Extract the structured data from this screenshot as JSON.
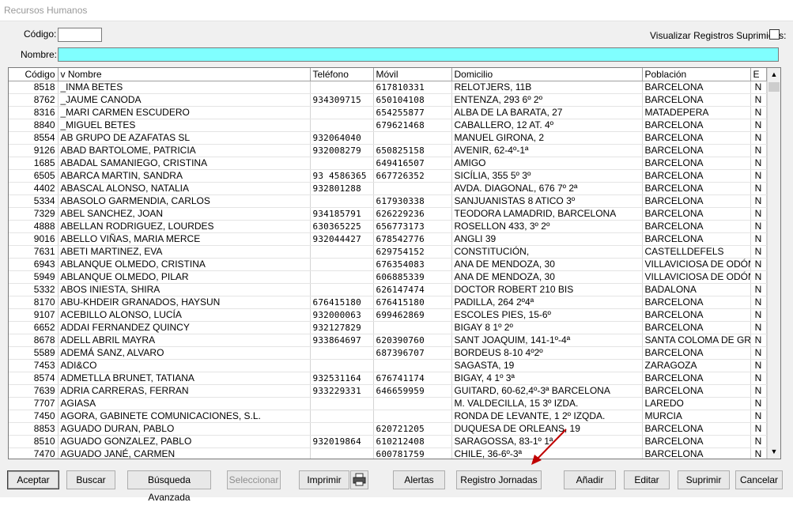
{
  "window": {
    "title": "Recursos Humanos"
  },
  "filters": {
    "codigo_label": "Código:",
    "codigo_value": "",
    "nombre_label": "Nombre:",
    "nombre_value": "",
    "suprimidos_label": "Visualizar Registros Suprimidos:",
    "suprimidos_checked": false
  },
  "grid": {
    "columns": [
      "Código",
      "v Nombre",
      "Teléfono",
      "Móvil",
      "Domicilio",
      "Población",
      "E"
    ],
    "rows": [
      [
        "8518",
        "_INMA BETES",
        "",
        "617810331",
        "RELOTJERS, 11B",
        "BARCELONA",
        "N"
      ],
      [
        "8762",
        "_JAUME CANODA",
        "934309715",
        "650104108",
        "ENTENZA, 293 6º 2º",
        "BARCELONA",
        "N"
      ],
      [
        "8316",
        "_MARI CARMEN ESCUDERO",
        "",
        "654255877",
        "ALBA DE LA BARATA, 27",
        "MATADEPERA",
        "N"
      ],
      [
        "8840",
        "_MIGUEL BETES",
        "",
        "679621468",
        "CABALLERO, 12  AT. 4º",
        "BARCELONA",
        "N"
      ],
      [
        "8554",
        "AB GRUPO DE AZAFATAS SL",
        "932064040",
        "",
        "MANUEL GIRONA, 2",
        "BARCELONA",
        "N"
      ],
      [
        "9126",
        "ABAD BARTOLOME, PATRICIA",
        "932008279",
        "650825158",
        "AVENIR, 62-4º-1ª",
        "BARCELONA",
        "N"
      ],
      [
        "1685",
        "ABADAL SAMANIEGO, CRISTINA",
        "",
        "649416507",
        "AMIGO",
        "BARCELONA",
        "N"
      ],
      [
        "6505",
        "ABARCA MARTIN, SANDRA",
        "93 4586365",
        "667726352",
        "SICÍLIA, 355 5º 3º",
        "BARCELONA",
        "N"
      ],
      [
        "4402",
        "ABASCAL ALONSO, NATALIA",
        "932801288",
        "",
        "AVDA. DIAGONAL, 676  7º 2ª",
        "BARCELONA",
        "N"
      ],
      [
        "5334",
        "ABASOLO GARMENDIA, CARLOS",
        "",
        "617930338",
        "SANJUANISTAS 8 ATICO 3º",
        "BARCELONA",
        "N"
      ],
      [
        "7329",
        "ABEL SANCHEZ, JOAN",
        "934185791",
        "626229236",
        "TEODORA LAMADRID,  BARCELONA",
        "BARCELONA",
        "N"
      ],
      [
        "4888",
        "ABELLAN RODRIGUEZ, LOURDES",
        "630365225",
        "656773173",
        "ROSELLON 433, 3º 2º",
        "BARCELONA",
        "N"
      ],
      [
        "9016",
        "ABELLO VIÑAS, MARIA MERCE",
        "932044427",
        "678542776",
        "ANGLI 39",
        "BARCELONA",
        "N"
      ],
      [
        "7631",
        "ABETI MARTINEZ, EVA",
        "",
        "629754152",
        "CONSTITUCIÓN,",
        "CASTELLDEFELS",
        "N"
      ],
      [
        "6943",
        "ABLANQUE OLMEDO, CRISTINA",
        "",
        "676354083",
        "ANA DE MENDOZA, 30",
        "VILLAVICIOSA DE ODÓN",
        "N"
      ],
      [
        "5949",
        "ABLANQUE OLMEDO, PILAR",
        "",
        "606885339",
        "ANA DE MENDOZA, 30",
        "VILLAVICIOSA DE ODÓN",
        "N"
      ],
      [
        "5332",
        "ABOS INIESTA, SHIRA",
        "",
        "626147474",
        "DOCTOR ROBERT 210 BIS",
        "BADALONA",
        "N"
      ],
      [
        "8170",
        "ABU-KHDEIR GRANADOS, HAYSUN",
        "676415180",
        "676415180",
        "PADILLA, 264    2º4ª",
        "BARCELONA",
        "N"
      ],
      [
        "9107",
        "ACEBILLO ALONSO, LUCÍA",
        "932000063",
        "699462869",
        "ESCOLES PIES, 15-6º",
        "BARCELONA",
        "N"
      ],
      [
        "6652",
        "ADDAI FERNANDEZ QUINCY",
        "932127829",
        "",
        "BIGAY 8 1º 2º",
        "BARCELONA",
        "N"
      ],
      [
        "8678",
        "ADELL ABRIL MAYRA",
        "933864697",
        "620390760",
        "SANT JOAQUIM, 141-1º-4ª",
        "SANTA COLOMA DE GRAMENET",
        "N"
      ],
      [
        "5589",
        "ADEMÁ SANZ, ALVARO",
        "",
        "687396707",
        "BORDEUS 8-10  4º2º",
        "BARCELONA",
        "N"
      ],
      [
        "7453",
        "ADI&CO",
        "",
        "",
        "SAGASTA, 19",
        "ZARAGOZA",
        "N"
      ],
      [
        "8574",
        "ADMETLLA BRUNET, TATIANA",
        "932531164",
        "676741174",
        "BIGAY, 4 1º 3ª",
        "BARCELONA",
        "N"
      ],
      [
        "7639",
        "ADRIA CARRERAS, FERRAN",
        "933229331",
        "646659959",
        "GUITARD, 60-62,4º-3ª BARCELONA",
        "BARCELONA",
        "N"
      ],
      [
        "7707",
        "AGIASA",
        "",
        "",
        "M. VALDECILLA, 15 3º IZDA.",
        "LAREDO",
        "N"
      ],
      [
        "7450",
        "AGORA, GABINETE COMUNICACIONES, S.L.",
        "",
        "",
        "RONDA DE LEVANTE, 1 2º IZQDA.",
        "MURCIA",
        "N"
      ],
      [
        "8853",
        "AGUADO DURAN, PABLO",
        "",
        "620721205",
        "DUQUESA DE ORLEANS, 19",
        "BARCELONA",
        "N"
      ],
      [
        "8510",
        "AGUADO GONZALEZ, PABLO",
        "932019864",
        "610212408",
        "SARAGOSSA, 83-1º 1ª",
        "BARCELONA",
        "N"
      ],
      [
        "7470",
        "AGUADO JANÉ, CARMEN",
        "",
        "600781759",
        "CHILE, 36-6º-3ª",
        "BARCELONA",
        "N"
      ]
    ]
  },
  "buttons": {
    "aceptar": "Aceptar",
    "buscar": "Buscar",
    "busqueda_avanzada": "Búsqueda Avanzada",
    "seleccionar": "Seleccionar",
    "imprimir": "Imprimir",
    "alertas": "Alertas",
    "registro_jornadas": "Registro Jornadas",
    "anadir": "Añadir",
    "editar": "Editar",
    "suprimir": "Suprimir",
    "cancelar": "Cancelar"
  },
  "colors": {
    "nombre_field": "#80ffff",
    "annotation_arrow": "#c00000"
  }
}
